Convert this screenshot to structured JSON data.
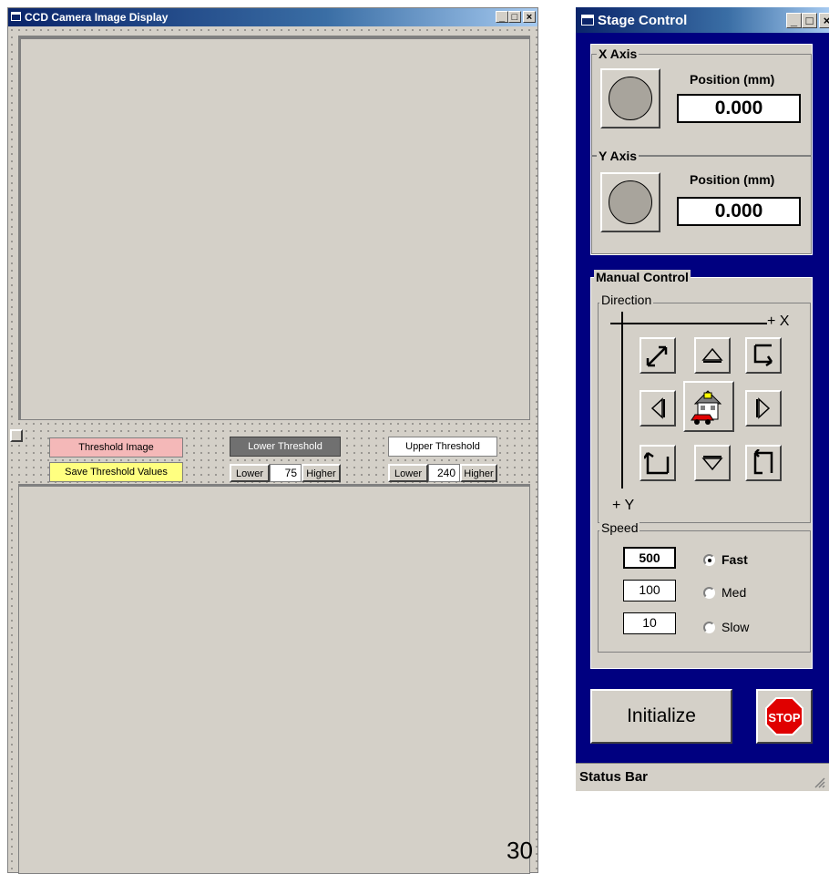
{
  "ccd_window": {
    "title": "CCD Camera Image Display",
    "threshold_button": "Threshold Image",
    "save_button": "Save Threshold Values",
    "lower_threshold": {
      "title": "Lower Threshold",
      "lower_label": "Lower",
      "value": "75",
      "higher_label": "Higher"
    },
    "upper_threshold": {
      "title": "Upper Threshold",
      "lower_label": "Lower",
      "value": "240",
      "higher_label": "Higher"
    },
    "colors": {
      "threshold_button": "#f4b8b8",
      "save_button": "#ffff80"
    }
  },
  "stage_window": {
    "title": "Stage Control",
    "x_axis": {
      "group_title": "X Axis",
      "position_label": "Position (mm)",
      "position_value": "0.000"
    },
    "y_axis": {
      "group_title": "Y Axis",
      "position_label": "Position (mm)",
      "position_value": "0.000"
    },
    "manual": {
      "group_title": "Manual Control",
      "direction_title": "Direction",
      "axis_x_label": "+ X",
      "axis_y_label": "+ Y",
      "speed_title": "Speed",
      "speeds": [
        {
          "value": "500",
          "label": "Fast",
          "selected": true
        },
        {
          "value": "100",
          "label": "Med",
          "selected": false
        },
        {
          "value": "10",
          "label": "Slow",
          "selected": false
        }
      ]
    },
    "initialize_button": "Initialize",
    "stop_label": "STOP",
    "status_bar": "Status Bar"
  },
  "page_number": "30"
}
